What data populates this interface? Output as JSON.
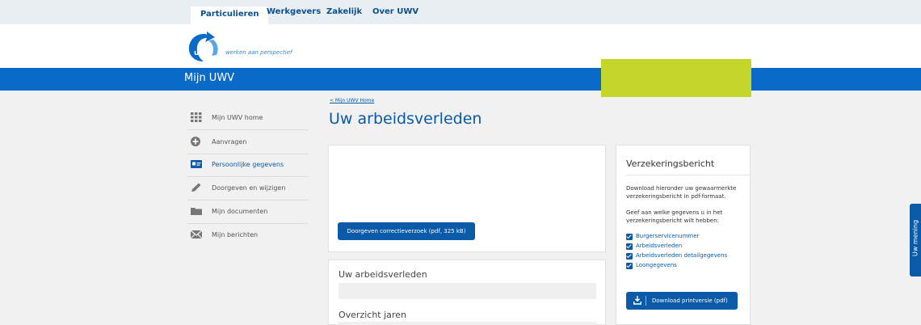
{
  "topnav": {
    "tabs": [
      {
        "label": "Particulieren",
        "active": true
      },
      {
        "label": "Werkgevers",
        "active": false
      },
      {
        "label": "Zakelijk",
        "active": false
      },
      {
        "label": "Over UWV",
        "active": false
      }
    ]
  },
  "logo": {
    "brand": "uwv",
    "tagline": "werken aan perspectief"
  },
  "banner": {
    "title": "Mijn UWV"
  },
  "sidebar": {
    "items": [
      {
        "label": "Mijn UWV home",
        "icon": "grid-icon"
      },
      {
        "label": "Aanvragen",
        "icon": "plus-circle-icon"
      },
      {
        "label": "Persoonlijke gegevens",
        "icon": "id-card-icon",
        "active": true
      },
      {
        "label": "Doorgeven en wijzigen",
        "icon": "pencil-icon"
      },
      {
        "label": "Mijn documenten",
        "icon": "folder-icon"
      },
      {
        "label": "Mijn berichten",
        "icon": "envelope-icon"
      }
    ]
  },
  "main": {
    "breadcrumb": "< Mijn UWV Home",
    "title": "Uw arbeidsverleden",
    "correction_button": "Doorgeven correctieverzoek (pdf, 325 kB)",
    "section1_title": "Uw arbeidsverleden",
    "section2_title": "Overzicht jaren"
  },
  "verzekeringsbericht": {
    "title": "Verzekeringsbericht",
    "intro": "Download hieronder uw gewaarmerkte verzekeringsbericht in pdf-formaat.",
    "instruction": "Geef aan welke gegevens u in het verzekeringsbericht wilt hebben:",
    "options": [
      {
        "label": "Burgerservicenummer",
        "checked": true
      },
      {
        "label": "Arbeidsverleden",
        "checked": true
      },
      {
        "label": "Arbeidsverleden detailgegevens",
        "checked": true
      },
      {
        "label": "Loongegevens",
        "checked": true
      }
    ],
    "download_button": "Download printversie (pdf)"
  },
  "feedback_tab": "Uw mening",
  "colors": {
    "brand_blue": "#0a6ac8",
    "link_blue": "#0a5aa8",
    "promo_green": "#c5d62a"
  }
}
